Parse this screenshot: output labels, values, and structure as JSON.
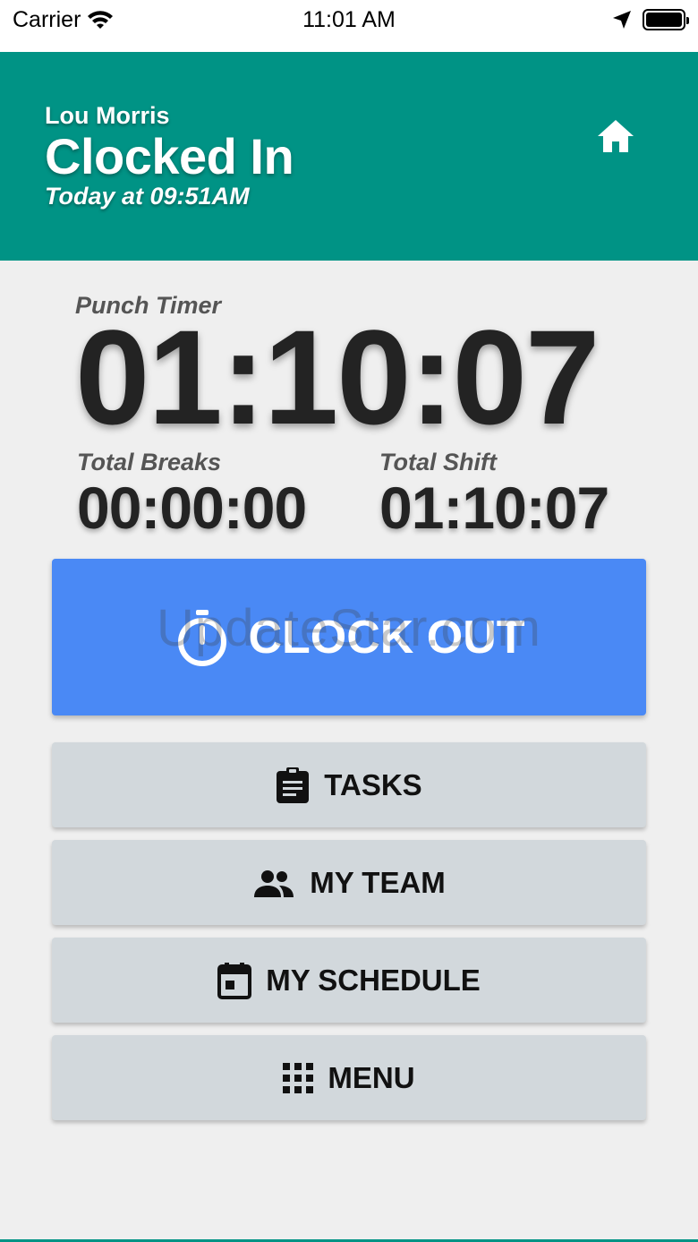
{
  "status_bar": {
    "carrier": "Carrier",
    "time": "11:01 AM"
  },
  "header": {
    "user_name": "Lou Morris",
    "status": "Clocked In",
    "since": "Today at 09:51AM",
    "bg_color": "#009385"
  },
  "timers": {
    "punch_label": "Punch Timer",
    "punch_value": "01:10:07",
    "breaks_label": "Total Breaks",
    "breaks_value": "00:00:00",
    "shift_label": "Total Shift",
    "shift_value": "01:10:07"
  },
  "actions": {
    "clock_out_label": "CLOCK OUT",
    "clock_out_color": "#4a89f5",
    "watermark": "UpdateStar.com",
    "tasks_label": "TASKS",
    "team_label": "MY TEAM",
    "schedule_label": "MY SCHEDULE",
    "menu_label": "MENU"
  },
  "icons": {
    "wifi": "wifi-icon",
    "location": "location-arrow-icon",
    "battery": "battery-icon",
    "home": "home-icon",
    "timer": "timer-icon",
    "tasks": "clipboard-icon",
    "team": "people-icon",
    "schedule": "calendar-icon",
    "menu": "grid-icon"
  }
}
